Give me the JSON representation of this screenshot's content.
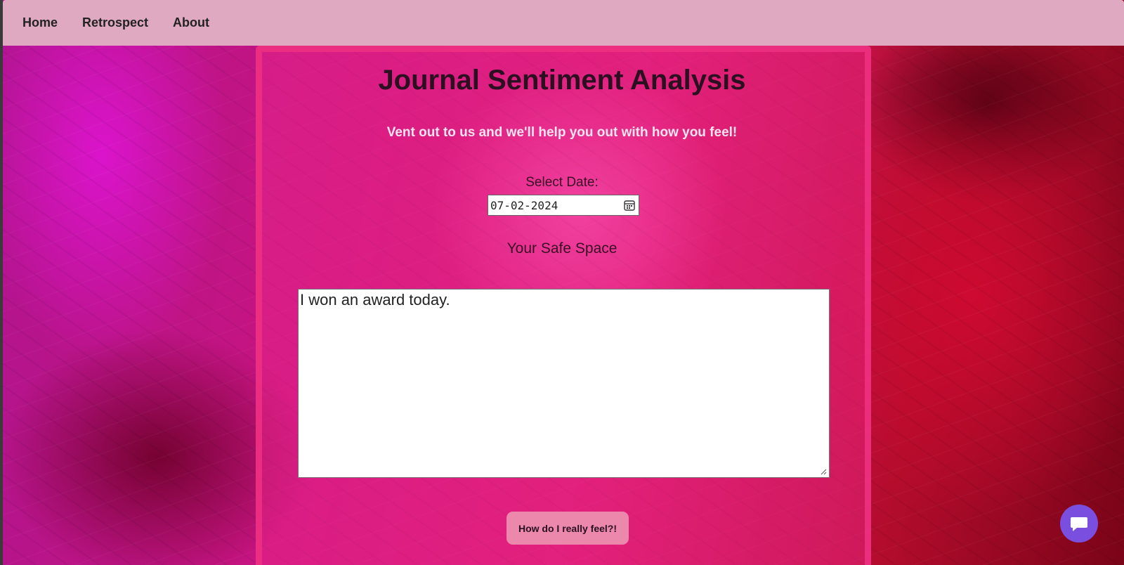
{
  "nav": {
    "items": [
      {
        "label": "Home"
      },
      {
        "label": "Retrospect"
      },
      {
        "label": "About"
      }
    ]
  },
  "main": {
    "title": "Journal Sentiment Analysis",
    "subtitle": "Vent out to us and we'll help you out with how you feel!",
    "date_label": "Select Date:",
    "date_value": "07-02-2024",
    "safe_space_label": "Your Safe Space",
    "journal_text": "I won an award today.",
    "submit_label": "How do I really feel?!"
  },
  "icons": {
    "calendar": "calendar-icon",
    "chat": "chat-icon"
  },
  "colors": {
    "navbar": "#e0a9c2",
    "button": "#ec88ab",
    "chat": "#7a4fe0"
  }
}
